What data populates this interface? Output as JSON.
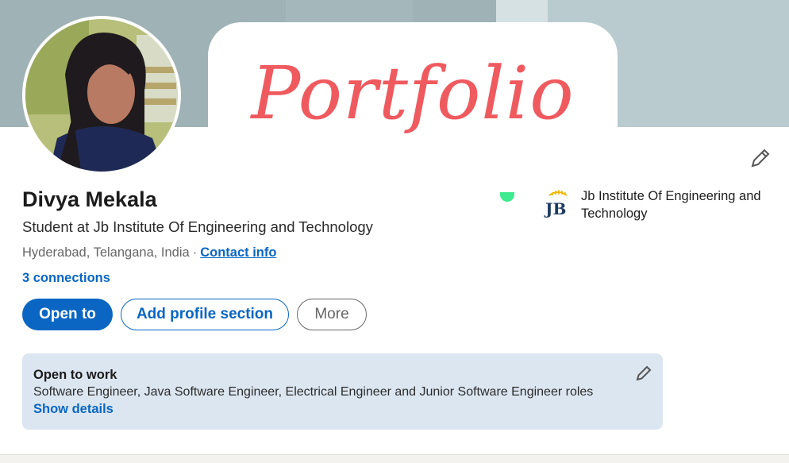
{
  "banner": {
    "overlay_text": "Portfolio",
    "overlay_color": "#ef5a5f"
  },
  "profile": {
    "name": "Divya Mekala",
    "headline": "Student at Jb Institute Of Engineering and Technology",
    "location": "Hyderabad, Telangana, India",
    "separator": "·",
    "contact_info_label": "Contact info",
    "connections_label": "3 connections",
    "avatar_icon": "profile-photo",
    "edit_icon": "pencil-icon"
  },
  "education": {
    "logo_text": "JB",
    "school_name": "Jb Institute Of Engineering and Technology"
  },
  "actions": {
    "open_to_label": "Open to",
    "add_section_label": "Add profile section",
    "more_label": "More"
  },
  "open_to_work": {
    "title": "Open to work",
    "roles": "Software Engineer, Java Software Engineer, Electrical Engineer and Junior Software Engineer roles",
    "show_details_label": "Show details",
    "edit_icon": "pencil-icon"
  },
  "colors": {
    "primary": "#0a66c2",
    "status_dot": "#3eea8f",
    "open_to_work_bg": "#dce6f1"
  }
}
